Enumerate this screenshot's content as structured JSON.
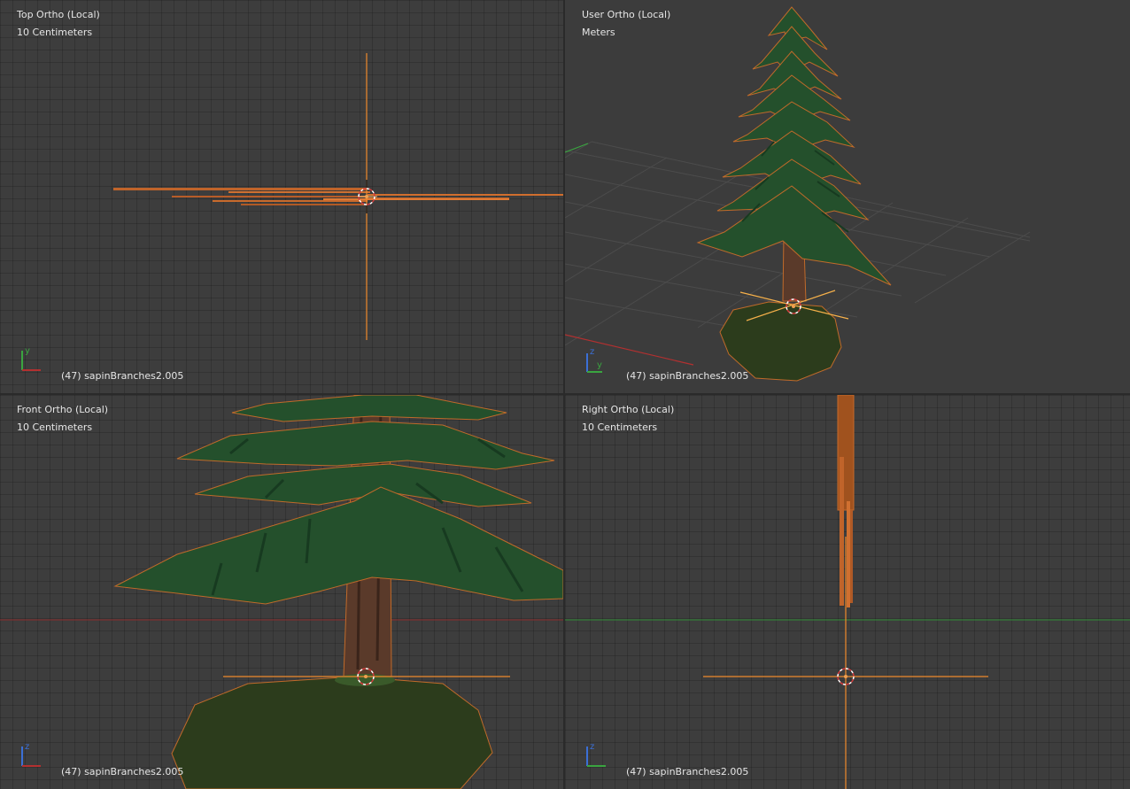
{
  "colors": {
    "viewport_bg": "#3d3d3d",
    "grid": "#353535",
    "selection_orange": "#f08a2c",
    "trunk_brown": "#5a3a2a",
    "foliage_green": "#24502c",
    "ground_green": "#2c3c1c",
    "axis_x": "#b33030",
    "axis_y": "#3aa540",
    "axis_z": "#3b6fd6"
  },
  "viewports": [
    {
      "id": "top",
      "title": "Top Ortho (Local)",
      "units": "10 Centimeters",
      "object": "(47) sapinBranches2.005",
      "axes": [
        "y"
      ]
    },
    {
      "id": "user",
      "title": "User Ortho (Local)",
      "units": "Meters",
      "object": "(47) sapinBranches2.005",
      "axes": [
        "z",
        "y"
      ]
    },
    {
      "id": "front",
      "title": "Front Ortho (Local)",
      "units": "10 Centimeters",
      "object": "(47) sapinBranches2.005",
      "axes": [
        "z"
      ]
    },
    {
      "id": "right",
      "title": "Right Ortho (Local)",
      "units": "10 Centimeters",
      "object": "(47) sapinBranches2.005",
      "axes": [
        "z"
      ]
    }
  ]
}
